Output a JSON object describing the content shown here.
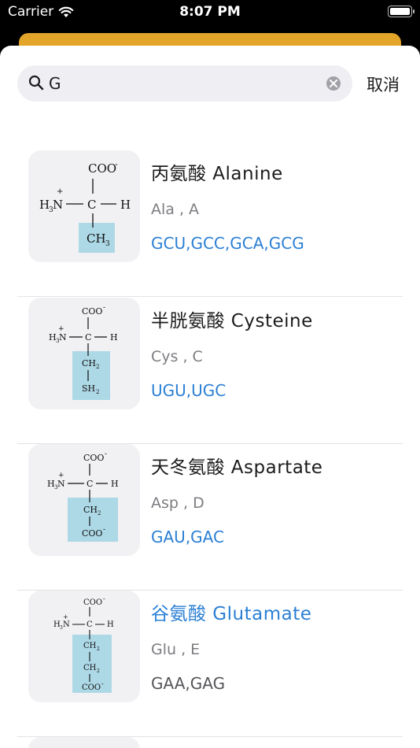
{
  "status": {
    "carrier": "Carrier",
    "time": "8:07 PM"
  },
  "search": {
    "value": "G",
    "cancel": "取消"
  },
  "chem": {
    "coo": "COO",
    "minus": "-",
    "h3n": "H",
    "sub3": "3",
    "n": "N",
    "plus": "+",
    "c": "C",
    "h": "H",
    "ch3": "CH",
    "ch2": "CH",
    "sub2": "2",
    "sh": "SH"
  },
  "items": [
    {
      "name": "丙氨酸 Alanine",
      "abbr": "Ala , A",
      "codons": "GCU,GCC,GCA,GCG"
    },
    {
      "name": "半胱氨酸 Cysteine",
      "abbr": "Cys , C",
      "codons": "UGU,UGC"
    },
    {
      "name": "天冬氨酸 Aspartate",
      "abbr": "Asp , D",
      "codons": "GAU,GAC"
    },
    {
      "name": "谷氨酸 Glutamate",
      "abbr": "Glu , E",
      "codons": "GAA,GAG"
    }
  ]
}
